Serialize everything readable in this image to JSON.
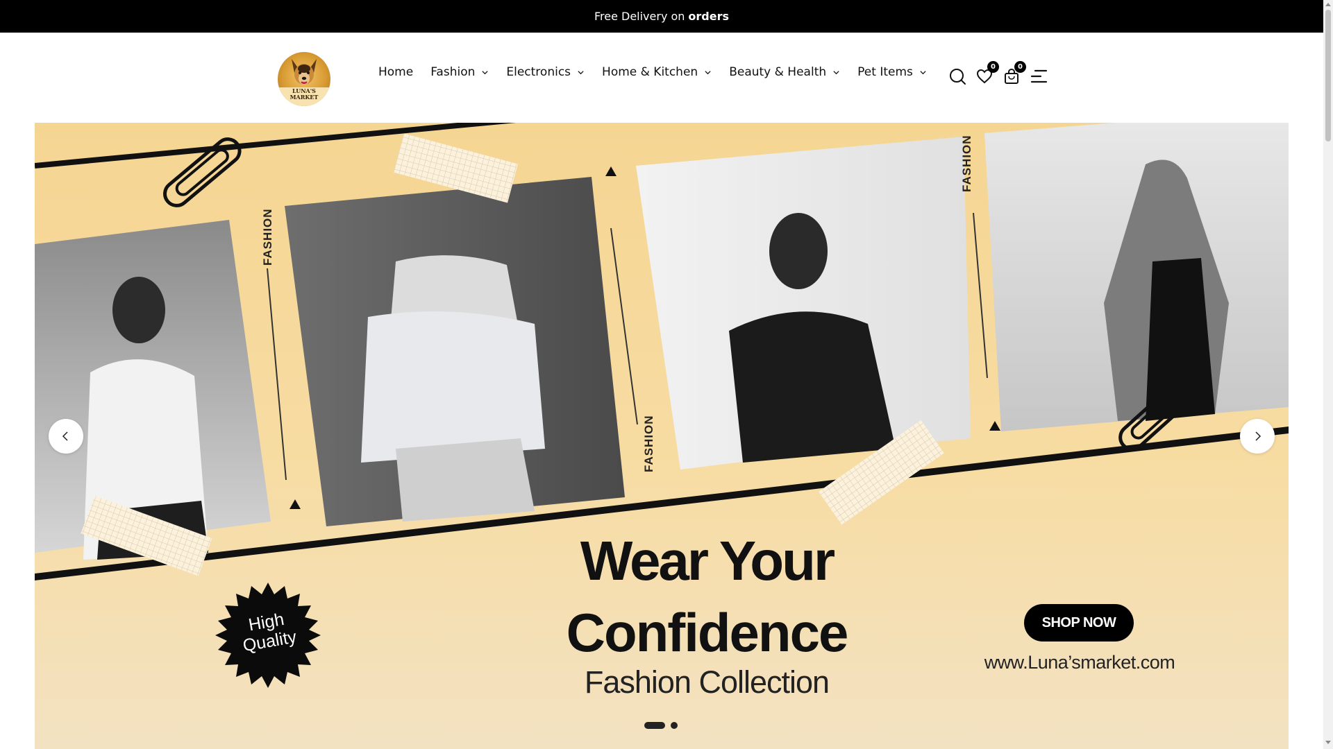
{
  "announcement": {
    "text": "Free Delivery on",
    "bold": "orders"
  },
  "brand": {
    "name": "LUNA'S",
    "sub": "MARKET"
  },
  "nav": [
    {
      "label": "Home",
      "has_dropdown": false
    },
    {
      "label": "Fashion",
      "has_dropdown": true
    },
    {
      "label": "Electronics",
      "has_dropdown": true
    },
    {
      "label": "Home & Kitchen",
      "has_dropdown": true
    },
    {
      "label": "Beauty & Health",
      "has_dropdown": true
    },
    {
      "label": "Pet Items",
      "has_dropdown": true
    }
  ],
  "header_icons": {
    "search": "search-icon",
    "wishlist": {
      "icon": "heart-icon",
      "count": "0"
    },
    "cart": {
      "icon": "shopping-bag-icon",
      "count": "0"
    },
    "menu": "menu-icon"
  },
  "hero": {
    "headline_1": "Wear Your",
    "headline_2": "Confidence",
    "subheadline": "Fashion Collection",
    "cta": "SHOP NOW",
    "url": "www.Luna’smarket.com",
    "seal_line_1": "High",
    "seal_line_2": "Quality",
    "side_label": "FASHION",
    "slides_total": 2,
    "active_slide": 1
  },
  "colors": {
    "topbar": "#000000",
    "banner_bg": "#f5d592",
    "accent": "#000000"
  }
}
